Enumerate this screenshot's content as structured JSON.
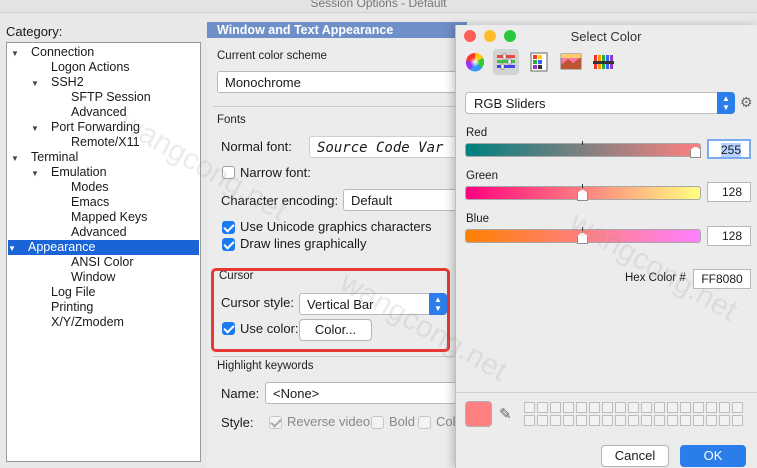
{
  "window": {
    "title": "Session Options - Default"
  },
  "category": {
    "label": "Category:",
    "items": [
      {
        "label": "Connection",
        "expanded": true
      },
      {
        "label": "Logon Actions"
      },
      {
        "label": "SSH2",
        "expanded": true
      },
      {
        "label": "SFTP Session"
      },
      {
        "label": "Advanced"
      },
      {
        "label": "Port Forwarding",
        "expanded": true
      },
      {
        "label": "Remote/X11"
      },
      {
        "label": "Terminal",
        "expanded": true
      },
      {
        "label": "Emulation",
        "expanded": true
      },
      {
        "label": "Modes"
      },
      {
        "label": "Emacs"
      },
      {
        "label": "Mapped Keys"
      },
      {
        "label": "Advanced"
      },
      {
        "label": "Appearance",
        "expanded": true,
        "selected": true
      },
      {
        "label": "ANSI Color"
      },
      {
        "label": "Window"
      },
      {
        "label": "Log File"
      },
      {
        "label": "Printing"
      },
      {
        "label": "X/Y/Zmodem"
      }
    ]
  },
  "panel": {
    "header": "Window and Text Appearance",
    "color_scheme_label": "Current color scheme",
    "color_scheme_value": "Monochrome",
    "fonts_label": "Fonts",
    "normal_font_label": "Normal font:",
    "normal_font_value": "Source Code Var",
    "narrow_font_label": "Narrow font:",
    "encoding_label": "Character encoding:",
    "encoding_value": "Default",
    "unicode_graphics_label": "Use Unicode graphics characters",
    "draw_lines_label": "Draw lines graphically",
    "cursor_label": "Cursor",
    "cursor_style_label": "Cursor style:",
    "cursor_style_value": "Vertical Bar",
    "use_color_label": "Use color:",
    "color_button_label": "Color...",
    "highlight_label": "Highlight keywords",
    "name_label": "Name:",
    "name_value": "<None>",
    "style_label": "Style:",
    "reverse_video_label": "Reverse video",
    "bold_label": "Bold",
    "col_label": "Col"
  },
  "color_dialog": {
    "title": "Select Color",
    "mode_value": "RGB Sliders",
    "red_label": "Red",
    "red_value": "255",
    "green_label": "Green",
    "green_value": "128",
    "blue_label": "Blue",
    "blue_value": "128",
    "hex_label": "Hex Color #",
    "hex_value": "FF8080",
    "cancel_label": "Cancel",
    "ok_label": "OK",
    "accent": "#2b7de9",
    "current_color": "#ff8080"
  },
  "watermark": "wangcong.net"
}
